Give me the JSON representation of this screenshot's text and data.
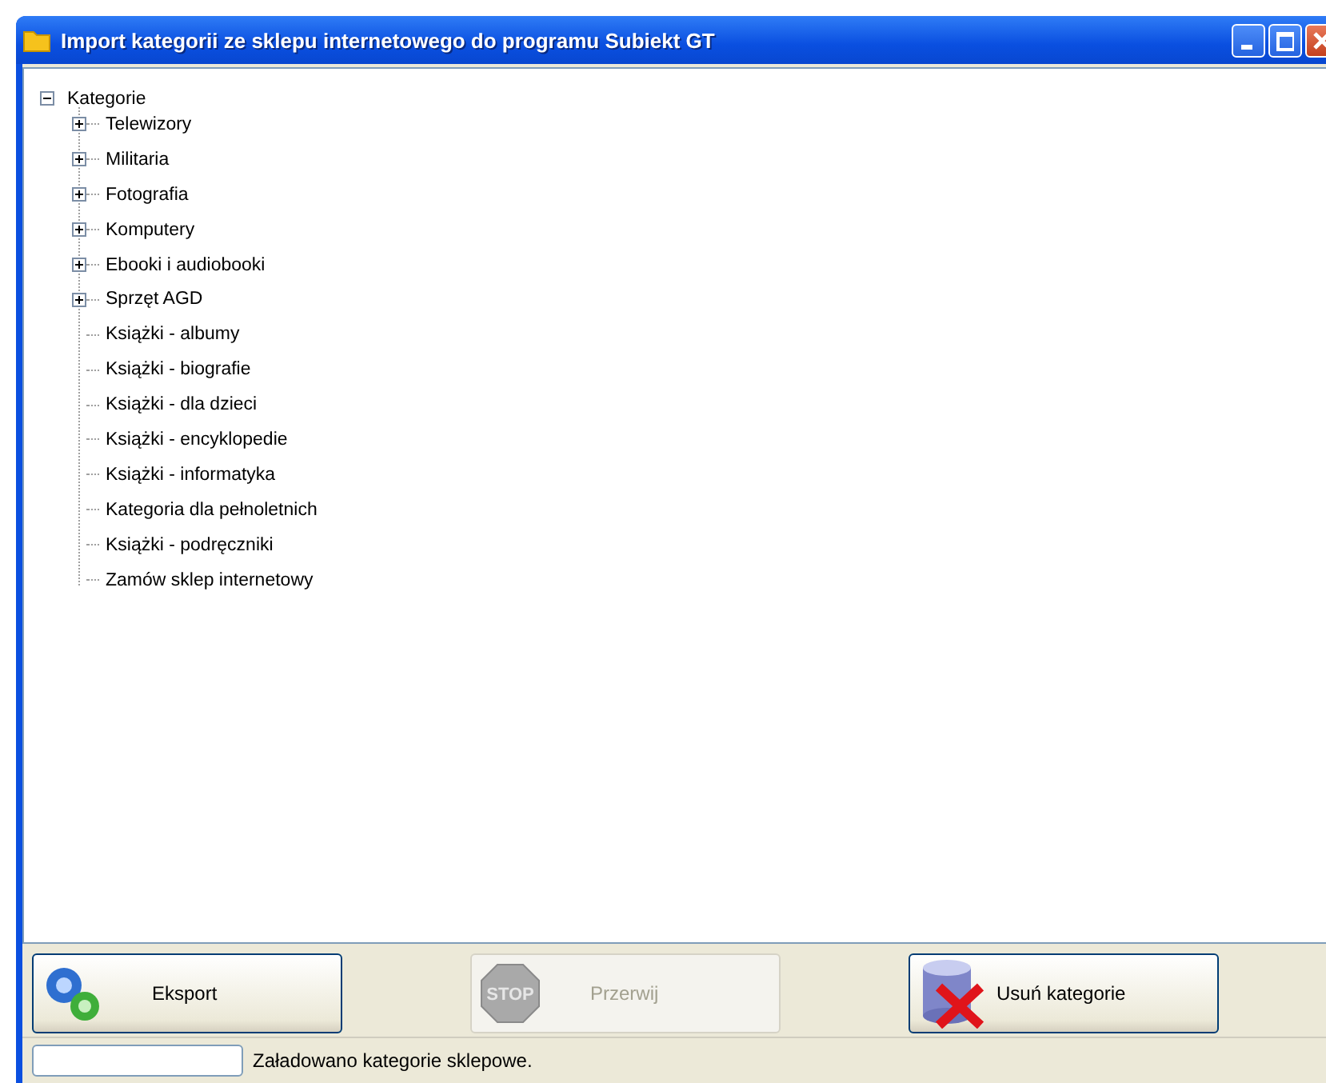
{
  "window": {
    "title": "Import kategorii ze sklepu internetowego do programu Subiekt GT"
  },
  "tree": {
    "root": {
      "label": "Kategorie",
      "expanded": true,
      "children": [
        {
          "label": "Telewizory",
          "kind": "branch",
          "expanded": false
        },
        {
          "label": "Militaria",
          "kind": "branch",
          "expanded": false
        },
        {
          "label": "Fotografia",
          "kind": "branch",
          "expanded": false
        },
        {
          "label": "Komputery",
          "kind": "branch",
          "expanded": false
        },
        {
          "label": "Ebooki i audiobooki",
          "kind": "branch",
          "expanded": false
        },
        {
          "label": "Sprzęt AGD",
          "kind": "branch",
          "expanded": false
        },
        {
          "label": "Książki - albumy",
          "kind": "leaf"
        },
        {
          "label": "Książki - biografie",
          "kind": "leaf"
        },
        {
          "label": "Książki - dla dzieci",
          "kind": "leaf"
        },
        {
          "label": "Książki - encyklopedie",
          "kind": "leaf"
        },
        {
          "label": "Książki - informatyka",
          "kind": "leaf"
        },
        {
          "label": "Kategoria dla pełnoletnich",
          "kind": "leaf"
        },
        {
          "label": "Książki - podręczniki",
          "kind": "leaf"
        },
        {
          "label": "Zamów sklep internetowy",
          "kind": "leaf"
        }
      ]
    }
  },
  "buttons": [
    {
      "label": "Eksport",
      "kind": "export",
      "disabled": false
    },
    {
      "label": "Przerwij",
      "kind": "stop",
      "disabled": true,
      "icon_text": "STOP"
    },
    {
      "label": "Usuń kategorie",
      "kind": "delete",
      "disabled": false
    }
  ],
  "status_bar": {
    "progress": {
      "level": 0
    },
    "message": "Załadowano kategorie sklepowe."
  }
}
